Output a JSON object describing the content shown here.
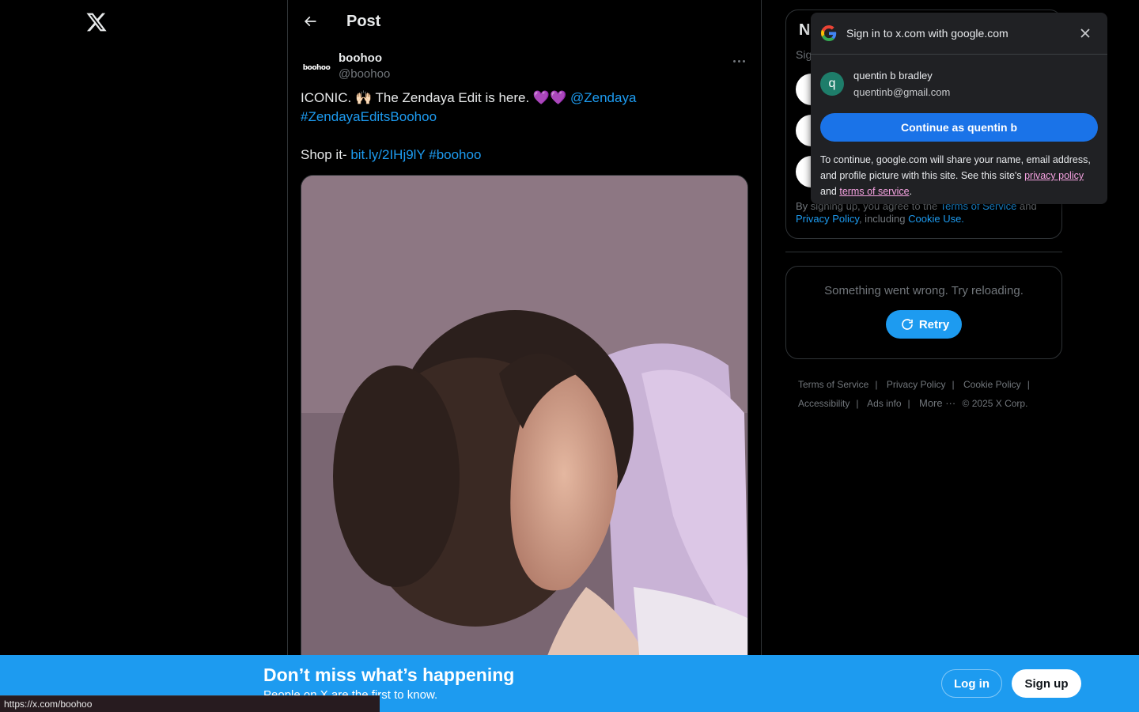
{
  "header": {
    "title": "Post"
  },
  "post": {
    "author": {
      "avatar_text": "boohoo",
      "display_name": "boohoo",
      "handle": "@boohoo"
    },
    "text": {
      "line1_text": "ICONIC. 🙌🏻 The Zendaya Edit is here. 💜💜 ",
      "mention": "@Zendaya",
      "hashtag1": "#ZendayaEditsBoohoo",
      "shop_prefix": "Shop it- ",
      "short_link": "bit.ly/2IHj9lY",
      "hashtag2": "#boohoo"
    }
  },
  "signup_card": {
    "heading_visible": "N",
    "subtext_visible": "Sig",
    "terms_prefix": "By signing up, you agree to the ",
    "terms_link": "Terms of Service",
    "and": " and",
    "privacy_link": "Privacy Policy",
    "including": ", including ",
    "cookie_link": "Cookie Use."
  },
  "error_card": {
    "message": "Something went wrong. Try reloading.",
    "retry_label": "Retry"
  },
  "footer": {
    "links": [
      "Terms of Service",
      "Privacy Policy",
      "Cookie Policy",
      "Accessibility",
      "Ads info"
    ],
    "more_label": "More ···",
    "copyright": "© 2025 X Corp."
  },
  "google_popup": {
    "title": "Sign in to x.com with google.com",
    "account_initial": "q",
    "account_name": "quentin b bradley",
    "account_email": "quentinb@gmail.com",
    "continue_label": "Continue as quentin b",
    "note_prefix": "To continue, google.com will share your name, email address, and profile picture with this site. See this site's ",
    "privacy_link": "privacy policy",
    "note_and": " and ",
    "terms_link": "terms of service",
    "note_end": "."
  },
  "banner": {
    "title": "Don’t miss what’s happening",
    "subtitle": "People on X are the first to know.",
    "login_label": "Log in",
    "signup_label": "Sign up"
  },
  "status_bar": {
    "url": "https://x.com/boohoo"
  },
  "colors": {
    "accent": "#1d9bf0",
    "google_blue": "#1a73e8",
    "background": "#000000"
  }
}
